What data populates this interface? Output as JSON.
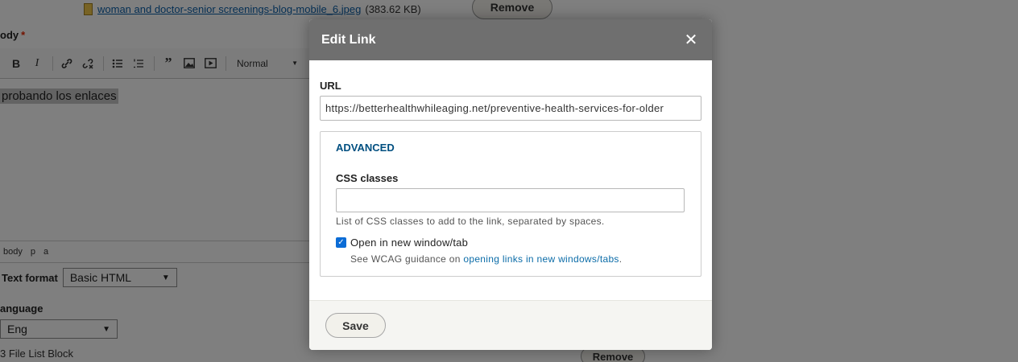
{
  "background": {
    "file_name": "woman and doctor-senior screenings-blog-mobile_6.jpeg",
    "file_size": "(383.62 KB)",
    "remove_label": "Remove",
    "body_label": "ody",
    "required_mark": "*",
    "toolbar": {
      "bold": "B",
      "italic": "I",
      "format_select": "Normal"
    },
    "editor_text": "probando los enlaces",
    "path": [
      "body",
      "p",
      "a"
    ],
    "text_format_label": "Text format",
    "text_format_value": "Basic HTML",
    "language_label": "anguage",
    "language_value": "Eng",
    "file_list_label": "3 File List Block",
    "remove_label_bottom": "Remove"
  },
  "dialog": {
    "title": "Edit Link",
    "close_glyph": "✕",
    "url_label": "URL",
    "url_value": "https://betterhealthwhileaging.net/preventive-health-services-for-older",
    "advanced_title": "ADVANCED",
    "css_label": "CSS classes",
    "css_value": "",
    "css_description": "List of CSS classes to add to the link, separated by spaces.",
    "new_window_label": "Open in new window/tab",
    "new_window_checked": true,
    "wcag_prefix": "See WCAG guidance on ",
    "wcag_link": "opening links in new windows/tabs",
    "wcag_suffix": ".",
    "save_label": "Save"
  }
}
